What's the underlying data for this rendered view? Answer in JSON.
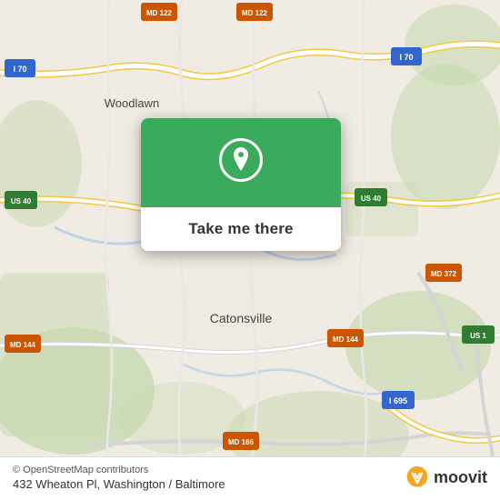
{
  "map": {
    "attribution": "© OpenStreetMap contributors",
    "address": "432 Wheaton Pl, Washington / Baltimore",
    "popup": {
      "button_label": "Take me there"
    },
    "accent_color": "#3aaa5c",
    "bg_color": "#e8e0d8"
  },
  "branding": {
    "name": "moovit",
    "logo_alt": "Moovit logo"
  },
  "icons": {
    "location_pin": "location-pin-icon",
    "moovit_logo": "moovit-brand-icon"
  }
}
